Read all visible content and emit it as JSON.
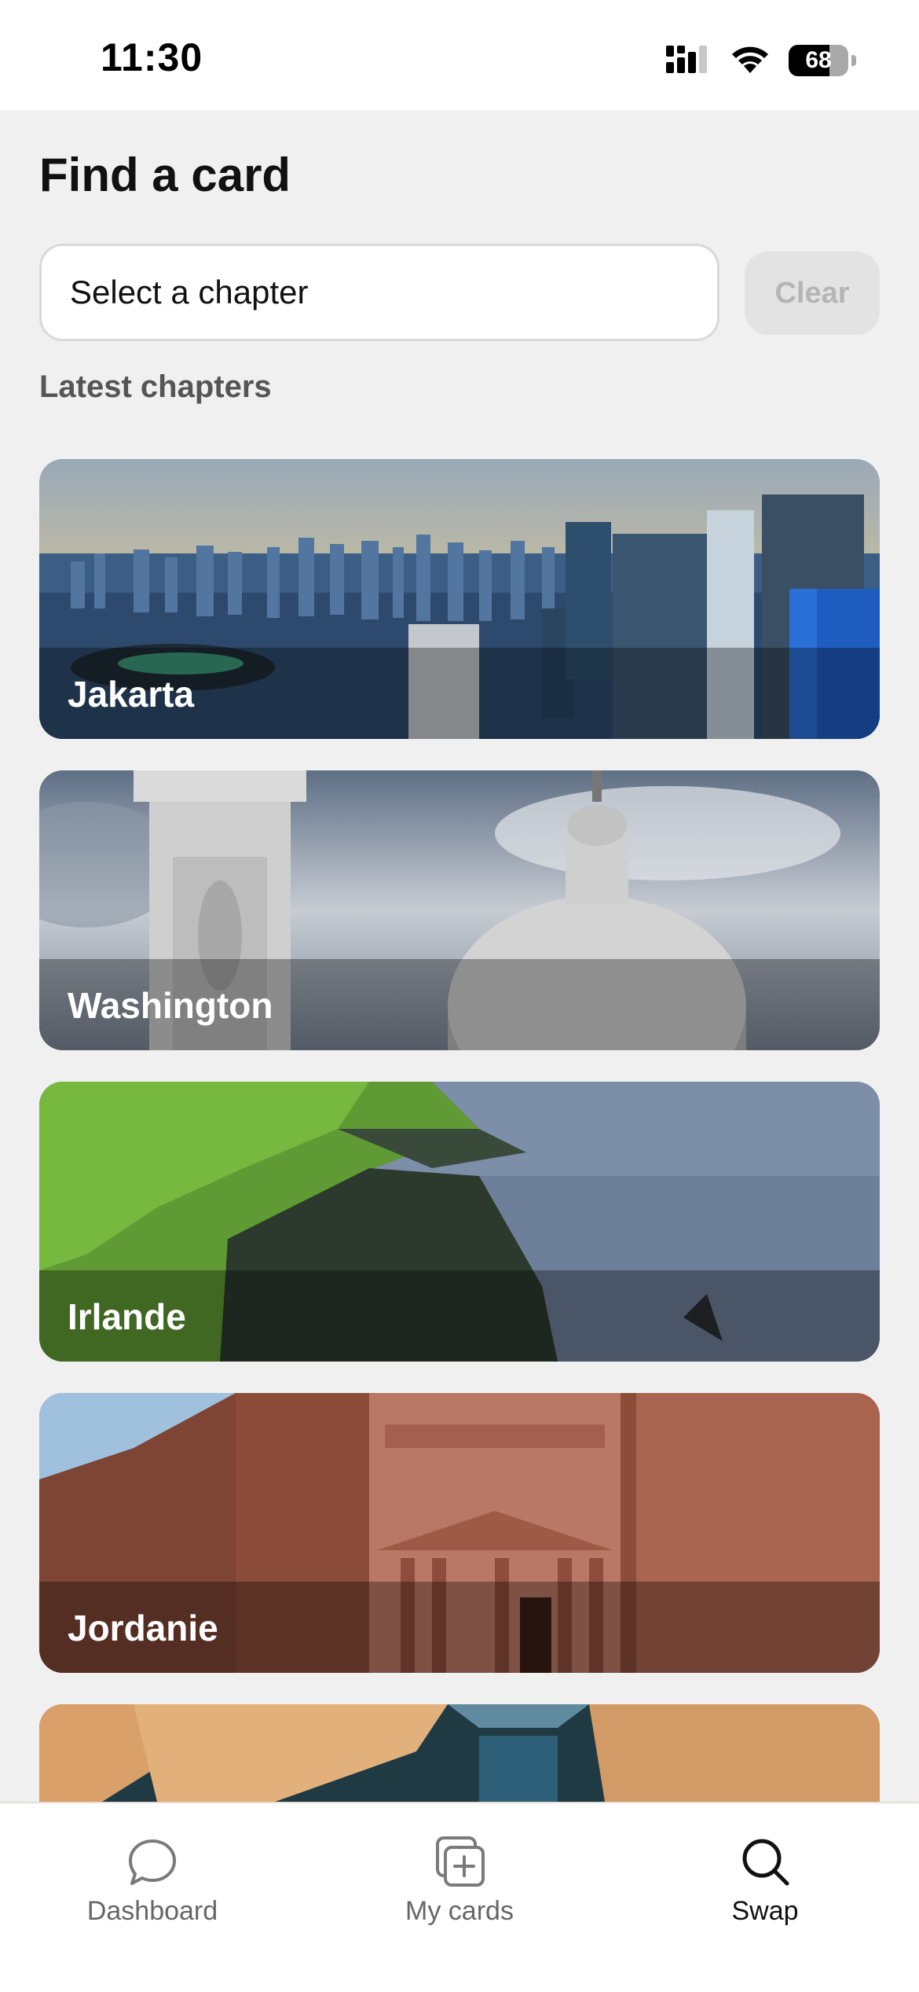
{
  "status_bar": {
    "time": "11:30",
    "battery_percent": "68",
    "battery_level": 0.68,
    "icons": [
      "cellular-signal-icon",
      "wifi-icon",
      "battery-icon"
    ]
  },
  "header": {
    "title": "Find a card",
    "select_placeholder": "Select a chapter",
    "clear_label": "Clear"
  },
  "section": {
    "label": "Latest chapters"
  },
  "chapters": [
    {
      "name": "Jakarta"
    },
    {
      "name": "Washington"
    },
    {
      "name": "Irlande"
    },
    {
      "name": "Jordanie"
    },
    {
      "name": ""
    }
  ],
  "tabbar": {
    "tabs": [
      {
        "label": "Dashboard",
        "icon": "chat-bubble-icon",
        "active": false
      },
      {
        "label": "My cards",
        "icon": "add-card-icon",
        "active": false
      },
      {
        "label": "Swap",
        "icon": "search-icon",
        "active": true
      }
    ]
  },
  "colors": {
    "background": "#f0f0f0",
    "surface": "#ffffff",
    "clear_bg": "#e3e3e3",
    "muted_text": "#666666"
  }
}
